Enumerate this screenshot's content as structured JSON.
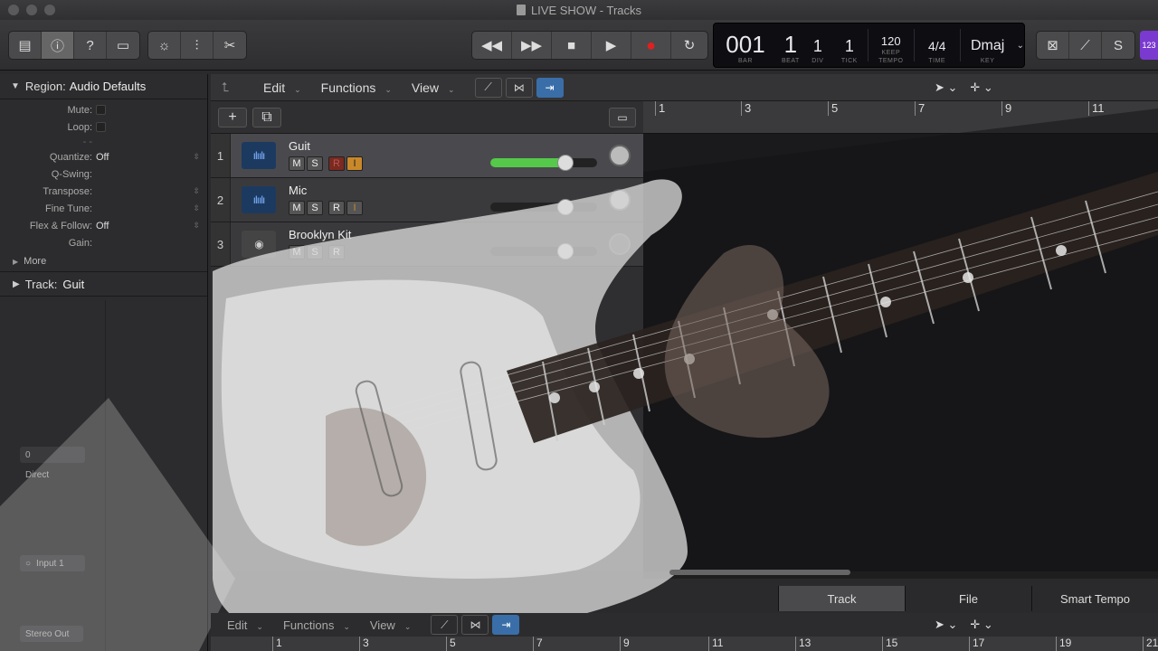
{
  "window": {
    "title": "LIVE SHOW - Tracks"
  },
  "control_bar": {
    "lcd": {
      "bar": "1",
      "beat": "1",
      "div": "1",
      "tick": "1",
      "bar_ghost": "00",
      "tempo": "120",
      "tempo_mode": "KEEP",
      "time": "4/4",
      "key": "Dmaj",
      "labels": {
        "bar": "BAR",
        "beat": "BEAT",
        "div": "DIV",
        "tick": "TICK",
        "tempo": "TEMPO",
        "time": "TIME",
        "key": "KEY"
      }
    },
    "badge": "123"
  },
  "inspector": {
    "region_label": "Region:",
    "region_name": "Audio Defaults",
    "rows": [
      {
        "key": "Mute:",
        "value": ""
      },
      {
        "key": "Loop:",
        "value": ""
      },
      {
        "key": "Quantize:",
        "value": "Off"
      },
      {
        "key": "Q-Swing:",
        "value": ""
      },
      {
        "key": "Transpose:",
        "value": ""
      },
      {
        "key": "Fine Tune:",
        "value": ""
      },
      {
        "key": "Flex & Follow:",
        "value": "Off"
      },
      {
        "key": "Gain:",
        "value": ""
      }
    ],
    "more": "More",
    "track_label": "Track:",
    "track_name": "Guit",
    "channel": {
      "value": "0",
      "mode": "Direct",
      "input": "Input 1",
      "output": "Stereo Out"
    }
  },
  "tracks_toolbar": {
    "edit": "Edit",
    "functions": "Functions",
    "view": "View"
  },
  "tracks": [
    {
      "index": "1",
      "name": "Guit",
      "mute": "M",
      "solo": "S",
      "rec": "R",
      "input": "I",
      "volume": 0.7
    },
    {
      "index": "2",
      "name": "Mic",
      "mute": "M",
      "solo": "S",
      "rec": "R",
      "input": "I",
      "volume": 0.7
    },
    {
      "index": "3",
      "name": "Brooklyn Kit",
      "mute": "M",
      "solo": "S",
      "rec": "R",
      "volume": 0.7
    }
  ],
  "ruler": {
    "bars": [
      "1",
      "3",
      "5",
      "7",
      "9",
      "11"
    ]
  },
  "lower": {
    "tabs": [
      "Track",
      "File",
      "Smart Tempo"
    ],
    "toolbar": {
      "edit": "Edit",
      "functions": "Functions",
      "view": "View"
    },
    "ruler_bars": [
      "1",
      "3",
      "5",
      "7",
      "9",
      "11",
      "13",
      "15",
      "17",
      "19",
      "21"
    ]
  }
}
